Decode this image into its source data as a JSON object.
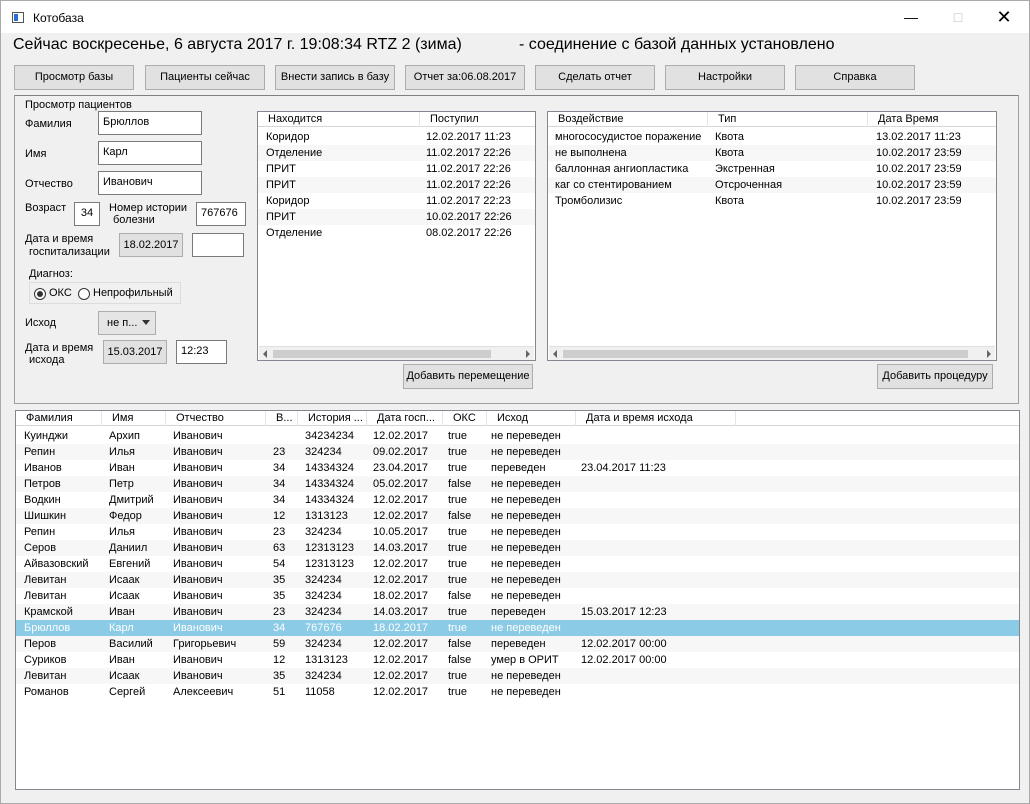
{
  "window": {
    "title": "Котобаза"
  },
  "status": {
    "datetime": "Сейчас воскресенье, 6 августа 2017 г. 19:08:34 RTZ 2 (зима)",
    "connection": "- соединение с базой данных установлено"
  },
  "toolbar": [
    "Просмотр базы",
    "Пациенты сейчас",
    "Внести запись в базу",
    "Отчет за:06.08.2017",
    "Сделать отчет",
    "Настройки",
    "Справка"
  ],
  "patient_view": {
    "group_title": "Просмотр пациентов",
    "surname_label": "Фамилия",
    "surname": "Брюллов",
    "name_label": "Имя",
    "name": "Карл",
    "patronymic_label": "Отчество",
    "patronymic": "Иванович",
    "age_label": "Возраст",
    "age": "34",
    "history_label_1": "Номер истории",
    "history_label_2": "болезни",
    "history": "767676",
    "hosp_label_1": "Дата и время",
    "hosp_label_2": "госпитализации",
    "hosp_date": "18.02.2017",
    "hosp_time": "",
    "diagnosis_label": "Диагноз:",
    "diag_oks": "ОКС",
    "diag_nonprofile": "Непрофильный",
    "outcome_label": "Исход",
    "outcome_value": "не п...",
    "outcome_dt_label_1": "Дата и время",
    "outcome_dt_label_2": "исхода",
    "outcome_date": "15.03.2017",
    "outcome_time": "12:23"
  },
  "movements": {
    "headers": [
      "Находится",
      "Поступил"
    ],
    "rows": [
      [
        "Коридор",
        "12.02.2017 11:23"
      ],
      [
        "Отделение",
        "11.02.2017 22:26"
      ],
      [
        "ПРИТ",
        "11.02.2017 22:26"
      ],
      [
        "ПРИТ",
        "11.02.2017 22:26"
      ],
      [
        "Коридор",
        "11.02.2017 22:23"
      ],
      [
        "ПРИТ",
        "10.02.2017 22:26"
      ],
      [
        "Отделение",
        "08.02.2017 22:26"
      ]
    ],
    "add_button": "Добавить перемещение"
  },
  "procedures": {
    "headers": [
      "Воздействие",
      "Тип",
      "Дата Время"
    ],
    "rows": [
      [
        "многососудистое поражение",
        "Квота",
        "13.02.2017 11:23"
      ],
      [
        "не выполнена",
        "Квота",
        "10.02.2017 23:59"
      ],
      [
        "баллонная ангиопластика",
        "Экстренная",
        "10.02.2017 23:59"
      ],
      [
        "каг со стентированием",
        "Отсроченная",
        "10.02.2017 23:59"
      ],
      [
        "Тромболизис",
        "Квота",
        "10.02.2017 23:59"
      ]
    ],
    "add_button": "Добавить процедуру"
  },
  "patients": {
    "headers": [
      "Фамилия",
      "Имя",
      "Отчество",
      "В...",
      "История ...",
      "Дата госп...",
      "ОКС",
      "Исход",
      "Дата и время исхода"
    ],
    "selected_index": 12,
    "rows": [
      [
        "Куинджи",
        "Архип",
        "Иванович",
        "",
        "34234234",
        "12.02.2017",
        "true",
        "не переведен",
        ""
      ],
      [
        "Репин",
        "Илья",
        "Иванович",
        "23",
        "324234",
        "09.02.2017",
        "true",
        "не переведен",
        ""
      ],
      [
        "Иванов",
        "Иван",
        "Иванович",
        "34",
        "14334324",
        "23.04.2017",
        "true",
        "переведен",
        "23.04.2017 11:23"
      ],
      [
        "Петров",
        "Петр",
        "Иванович",
        "34",
        "14334324",
        "05.02.2017",
        "false",
        "не переведен",
        ""
      ],
      [
        "Водкин",
        "Дмитрий",
        "Иванович",
        "34",
        "14334324",
        "12.02.2017",
        "true",
        "не переведен",
        ""
      ],
      [
        "Шишкин",
        "Федор",
        "Иванович",
        "12",
        "1313123",
        "12.02.2017",
        "false",
        "не переведен",
        ""
      ],
      [
        "Репин",
        "Илья",
        "Иванович",
        "23",
        "324234",
        "10.05.2017",
        "true",
        "не переведен",
        ""
      ],
      [
        "Серов",
        "Даниил",
        "Иванович",
        "63",
        "12313123",
        "14.03.2017",
        "true",
        "не переведен",
        ""
      ],
      [
        "Айвазовский",
        "Евгений",
        "Иванович",
        "54",
        "12313123",
        "12.02.2017",
        "true",
        "не переведен",
        ""
      ],
      [
        "Левитан",
        "Исаак",
        "Иванович",
        "35",
        "324234",
        "12.02.2017",
        "true",
        "не переведен",
        ""
      ],
      [
        "Левитан",
        "Исаак",
        "Иванович",
        "35",
        "324234",
        "18.02.2017",
        "false",
        "не переведен",
        ""
      ],
      [
        "Крамской",
        "Иван",
        "Иванович",
        "23",
        "324234",
        "14.03.2017",
        "true",
        "переведен",
        "15.03.2017 12:23"
      ],
      [
        "Брюллов",
        "Карл",
        "Иванович",
        "34",
        "767676",
        "18.02.2017",
        "true",
        "не переведен",
        ""
      ],
      [
        "Перов",
        "Василий",
        "Григорьевич",
        "59",
        "324234",
        "12.02.2017",
        "false",
        "переведен",
        "12.02.2017 00:00"
      ],
      [
        "Суриков",
        "Иван",
        "Иванович",
        "12",
        "1313123",
        "12.02.2017",
        "false",
        "умер в ОРИТ",
        "12.02.2017 00:00"
      ],
      [
        "Левитан",
        "Исаак",
        "Иванович",
        "35",
        "324234",
        "12.02.2017",
        "true",
        "не переведен",
        ""
      ],
      [
        "Романов",
        "Сергей",
        "Алексеевич",
        "51",
        "11058",
        "12.02.2017",
        "true",
        "не переведен",
        ""
      ]
    ]
  },
  "colors": {
    "selection": "#8ccbe6",
    "button_face": "#e1e1e1"
  }
}
